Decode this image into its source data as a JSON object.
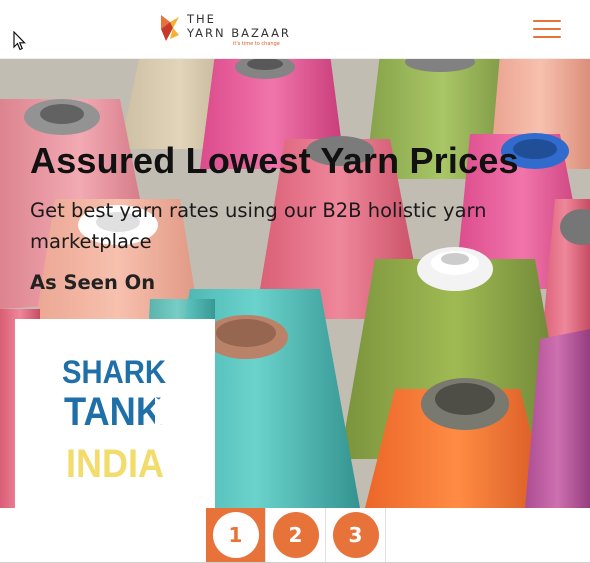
{
  "header": {
    "logo": {
      "line1": "THE",
      "line2": "YARN BAZAAR",
      "tagline": "it's time to change"
    },
    "menu_icon": "hamburger-icon"
  },
  "hero": {
    "title": "Assured Lowest Yarn Prices",
    "subtitle": "Get best yarn rates using our B2B holistic yarn marketplace",
    "seen_on": "As Seen On",
    "badge": {
      "line1": "SHARK",
      "line2": "TANK",
      "line3": "INDIA"
    }
  },
  "pager": {
    "pages": [
      "1",
      "2",
      "3"
    ],
    "active_page": "1"
  },
  "colors": {
    "accent": "#e8733a",
    "badge_blue": "#1f6fa8",
    "badge_yellow": "#f2dc6b"
  }
}
